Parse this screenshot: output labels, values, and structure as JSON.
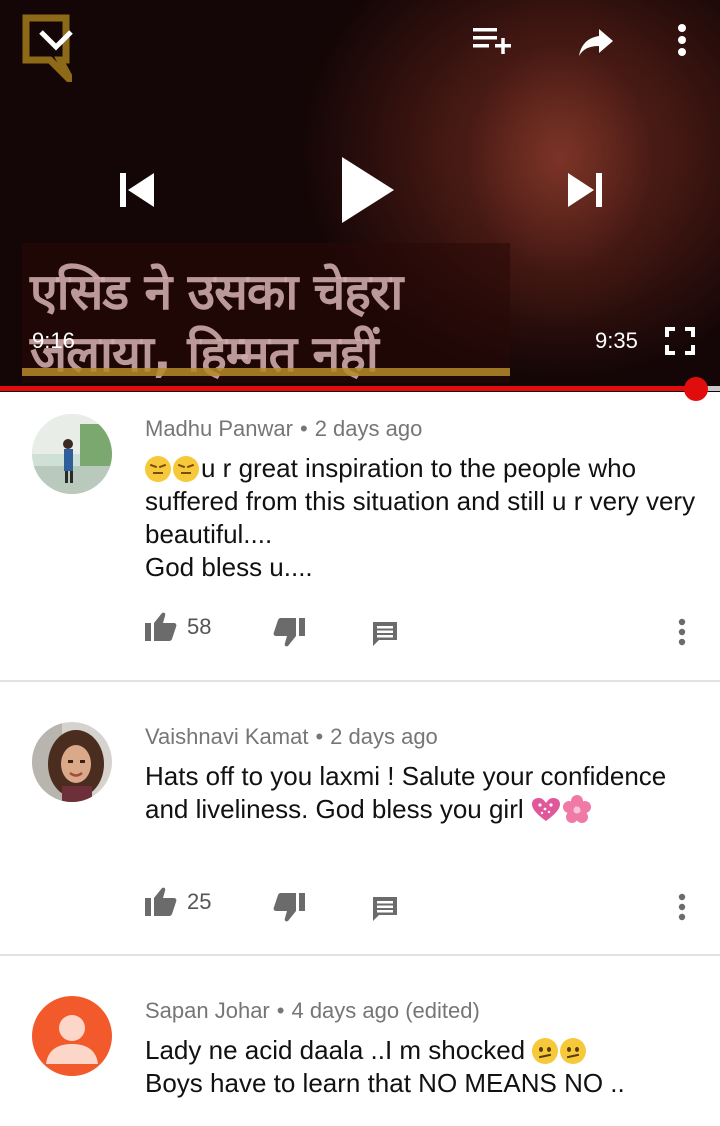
{
  "player": {
    "current_time": "9:16",
    "duration": "9:35",
    "progress_fraction": 0.967,
    "subtitle_line1": "एसिड ने उसका चेहरा",
    "subtitle_line2": "जलाया, हिम्मत नहीं",
    "icons": [
      "collapse-chevron-icon",
      "add-to-playlist-icon",
      "share-icon",
      "more-vert-icon",
      "previous-icon",
      "play-icon",
      "next-icon",
      "fullscreen-icon"
    ],
    "accent_color": "#e10d0d"
  },
  "comments": [
    {
      "author": "Madhu Panwar",
      "meta": "2 days ago",
      "text_line1": "u r great inspiration to the people who suffered from this situation and still u r very very beautiful....",
      "text_line2": "God bless u....",
      "likes": "58",
      "leading_emoji": [
        "disappointed-face",
        "disappointed-face"
      ]
    },
    {
      "author": "Vaishnavi Kamat",
      "meta": "2 days ago",
      "text_line1": "Hats off to you laxmi ! Salute your confidence and liveliness. God bless you girl",
      "likes": "25",
      "trailing_emoji": [
        "sparkling-heart",
        "cherry-blossom"
      ]
    },
    {
      "author": "Sapan Johar",
      "meta": "4 days ago (edited)",
      "text_line1": "Lady ne acid daala ..I m shocked",
      "text_line2": "Boys have to learn that NO MEANS NO ..",
      "trailing_emoji": [
        "confused-face",
        "confused-face"
      ],
      "avatar_color": "#f2592b"
    }
  ]
}
